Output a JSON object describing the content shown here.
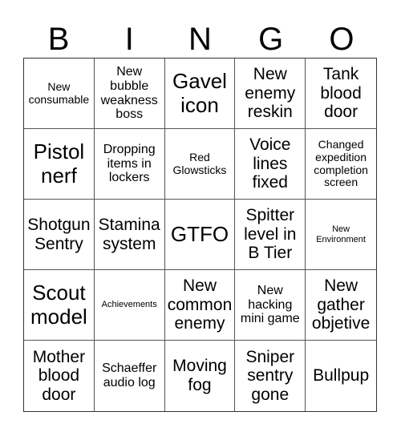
{
  "header": {
    "letters": [
      "B",
      "I",
      "N",
      "G",
      "O"
    ]
  },
  "cells": [
    {
      "text": "New consumable",
      "size": "sm"
    },
    {
      "text": "New bubble weakness boss",
      "size": "md"
    },
    {
      "text": "Gavel icon",
      "size": "xl"
    },
    {
      "text": "New enemy reskin",
      "size": "lg"
    },
    {
      "text": "Tank blood door",
      "size": "lg"
    },
    {
      "text": "Pistol nerf",
      "size": "xl"
    },
    {
      "text": "Dropping items in lockers",
      "size": "md"
    },
    {
      "text": "Red Glowsticks",
      "size": "sm"
    },
    {
      "text": "Voice lines fixed",
      "size": "lg"
    },
    {
      "text": "Changed expedition completion screen",
      "size": "sm"
    },
    {
      "text": "Shotgun Sentry",
      "size": "lg"
    },
    {
      "text": "Stamina system",
      "size": "lg"
    },
    {
      "text": "GTFO",
      "size": "xl"
    },
    {
      "text": "Spitter level in B Tier",
      "size": "lg"
    },
    {
      "text": "New Environment",
      "size": "xs"
    },
    {
      "text": "Scout model",
      "size": "xl"
    },
    {
      "text": "Achievements",
      "size": "xs"
    },
    {
      "text": "New common enemy",
      "size": "lg"
    },
    {
      "text": "New hacking mini game",
      "size": "md"
    },
    {
      "text": "New gather objetive",
      "size": "lg"
    },
    {
      "text": "Mother blood door",
      "size": "lg"
    },
    {
      "text": "Schaeffer audio log",
      "size": "md"
    },
    {
      "text": "Moving fog",
      "size": "lg"
    },
    {
      "text": "Sniper sentry gone",
      "size": "lg"
    },
    {
      "text": "Bullpup",
      "size": "lg"
    }
  ]
}
